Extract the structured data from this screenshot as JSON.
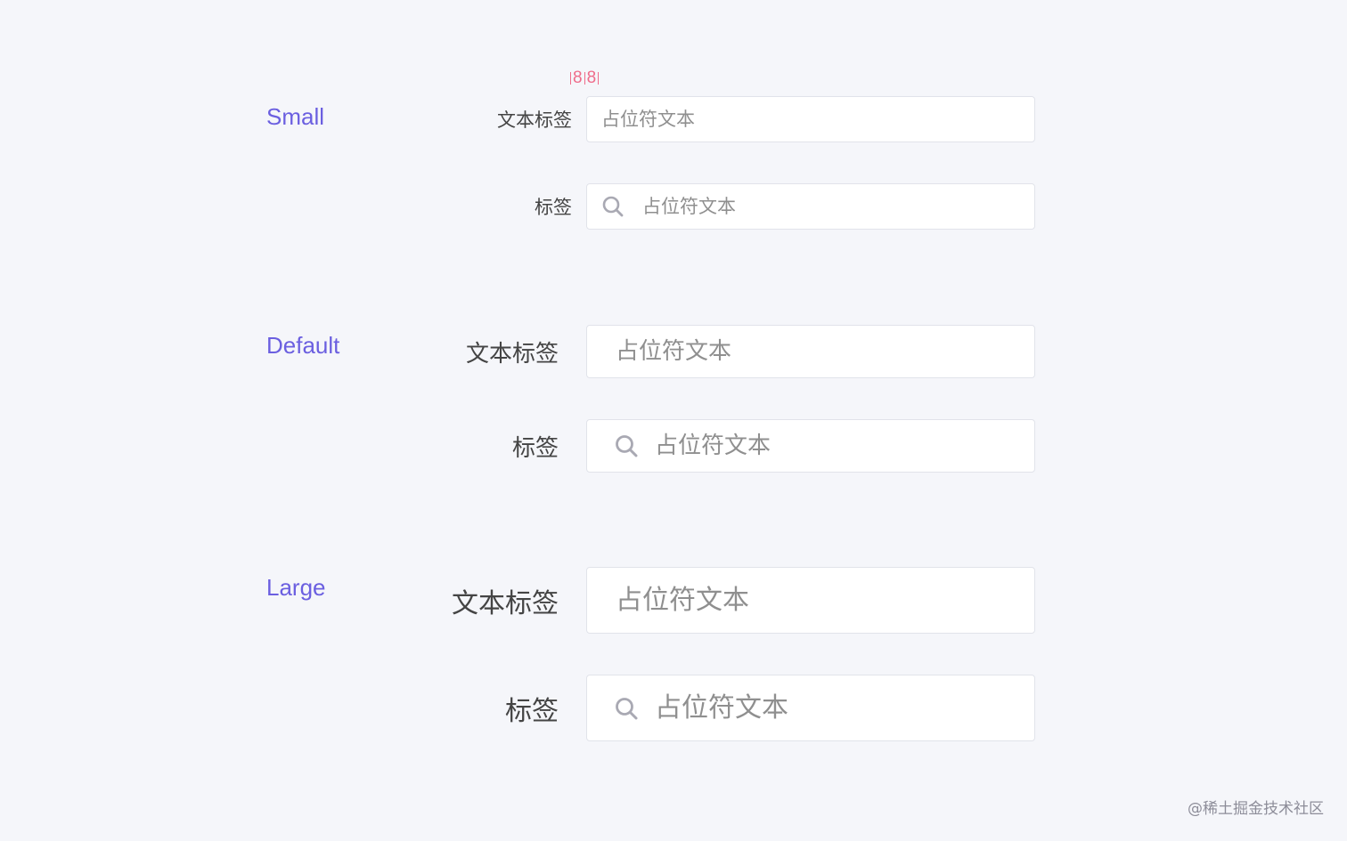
{
  "sizes": {
    "small": "Small",
    "default": "Default",
    "large": "Large"
  },
  "annotation": {
    "left_value": "8",
    "right_value": "8"
  },
  "labels": {
    "text_label": "文本标签",
    "short_label": "标签"
  },
  "placeholder": "占位符文本",
  "watermark": "@稀土掘金技术社区",
  "colors": {
    "size_label": "#6b5fe0",
    "annotation": "#ef6c8a",
    "background": "#f5f6fa",
    "input_border": "#e1e3ea",
    "placeholder": "#8f8f8f"
  },
  "icons": {
    "search": "search-icon"
  }
}
